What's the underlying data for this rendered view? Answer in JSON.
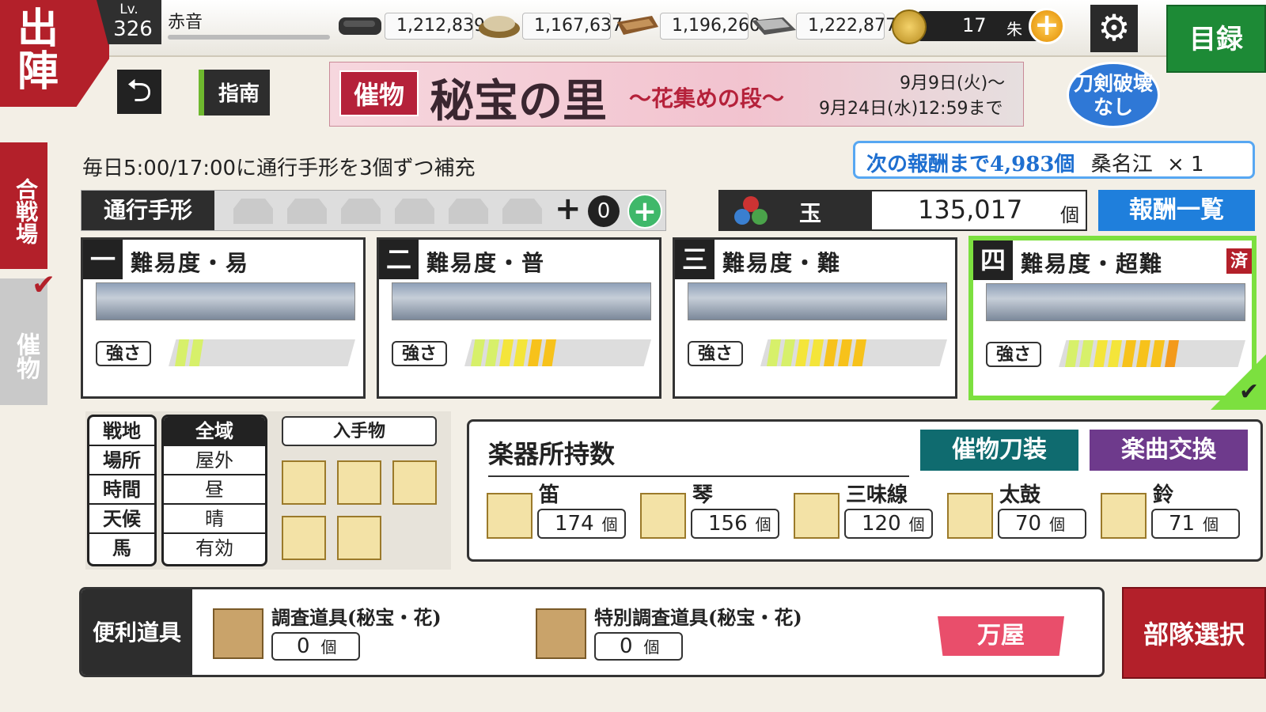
{
  "top": {
    "sortie_label": "出陣",
    "level_label": "Lv.",
    "level": "326",
    "user_name": "赤音",
    "resources": [
      {
        "icon": "charcoal-icon",
        "value": "1,212,839"
      },
      {
        "icon": "whetstone-icon",
        "value": "1,167,637"
      },
      {
        "icon": "cold-steel-icon",
        "value": "1,196,260"
      },
      {
        "icon": "steel-icon",
        "value": "1,222,877"
      }
    ],
    "koban_count": "17",
    "koban_label": "朱",
    "plus_label": "+",
    "settings_icon": "gear-icon",
    "catalog_label": "目録"
  },
  "nav": {
    "back_label": "⮌",
    "guide_label": "指南"
  },
  "banner": {
    "tag": "催物",
    "title": "秘宝の里",
    "subtitle": "〜花集めの段〜",
    "date_start": "9月9日(火)〜",
    "date_end": "9月24日(水)12:59まで"
  },
  "no_break_label": "刀剣破壊なし",
  "side_tabs": {
    "battle": "合戦場",
    "event": "催物"
  },
  "refill_text": "毎日5:00/17:00に通行手形を3個ずつ補充",
  "next_reward": {
    "prefix": "次の報酬まで4,983個",
    "item": "桑名江",
    "qty": "× 1"
  },
  "pass": {
    "label": "通行手形",
    "plus": "+",
    "count": "0",
    "add": "+"
  },
  "orb": {
    "label": "玉",
    "value": "135,017",
    "unit": "個",
    "reward_list_label": "報酬一覧"
  },
  "difficulties": [
    {
      "num": "一",
      "title": "難易度・易",
      "strength_label": "強さ",
      "level": 2,
      "done": false
    },
    {
      "num": "二",
      "title": "難易度・普",
      "strength_label": "強さ",
      "level": 6,
      "done": false
    },
    {
      "num": "三",
      "title": "難易度・難",
      "strength_label": "強さ",
      "level": 7,
      "done": false
    },
    {
      "num": "四",
      "title": "難易度・超難",
      "strength_label": "強さ",
      "level": 8,
      "done": true,
      "done_label": "済",
      "selected": true
    }
  ],
  "conditions": {
    "labels": [
      "戦地",
      "場所",
      "時間",
      "天候",
      "馬"
    ],
    "values": [
      "全域",
      "屋外",
      "昼",
      "晴",
      "有効"
    ],
    "obtain_label": "入手物"
  },
  "instruments": {
    "title": "楽器所持数",
    "katana_btn": "催物刀装",
    "song_btn": "楽曲交換",
    "items": [
      {
        "name": "笛",
        "count": "174",
        "unit": "個"
      },
      {
        "name": "琴",
        "count": "156",
        "unit": "個"
      },
      {
        "name": "三味線",
        "count": "120",
        "unit": "個"
      },
      {
        "name": "太鼓",
        "count": "70",
        "unit": "個"
      },
      {
        "name": "鈴",
        "count": "71",
        "unit": "個"
      }
    ]
  },
  "tools": {
    "label": "便利道具",
    "items": [
      {
        "name": "調査道具(秘宝・花)",
        "count": "0",
        "unit": "個"
      },
      {
        "name": "特別調査道具(秘宝・花)",
        "count": "0",
        "unit": "個"
      }
    ],
    "shop_label": "万屋"
  },
  "squad_label": "部隊選択"
}
